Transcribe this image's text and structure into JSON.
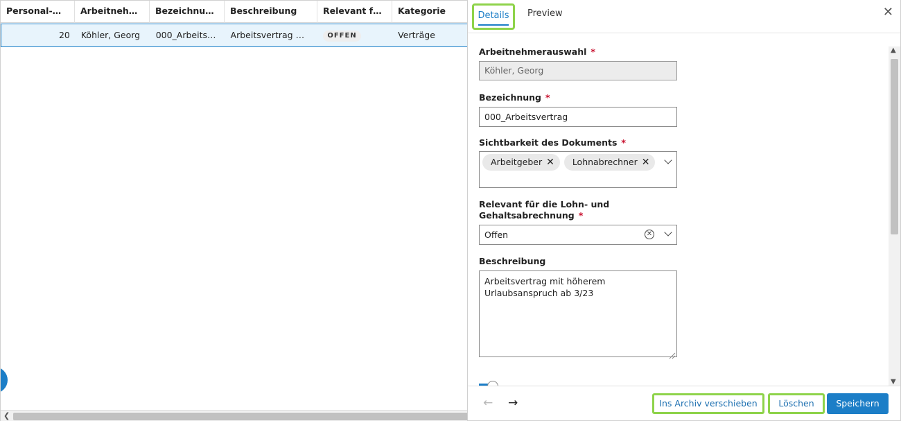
{
  "grid": {
    "columns": [
      "Personal-…",
      "Arbeitneh…",
      "Bezeichnu…",
      "Beschreibung",
      "Relevant für d…",
      "Kategorie"
    ],
    "rows": [
      {
        "personal_nr": "20",
        "arbeitnehmer": "Köhler, Georg",
        "bezeichnung": "000_Arbeitsve…",
        "beschreibung": "Arbeitsvertrag mit …",
        "relevant": "OFFEN",
        "kategorie": "Verträge"
      }
    ]
  },
  "panel": {
    "tabs": [
      {
        "label": "Details",
        "active": true
      },
      {
        "label": "Preview",
        "active": false
      }
    ],
    "form": {
      "arbeitnehmer_label": "Arbeitnehmerauswahl",
      "arbeitnehmer_value": "Köhler, Georg",
      "bezeichnung_label": "Bezeichnung",
      "bezeichnung_value": "000_Arbeitsvertrag",
      "sichtbarkeit_label": "Sichtbarkeit des Dokuments",
      "sichtbarkeit_chips": [
        "Arbeitgeber",
        "Lohnabrechner"
      ],
      "relevant_label_line1": "Relevant für die Lohn- und",
      "relevant_label_line2": "Gehaltsabrechnung",
      "relevant_value": "Offen",
      "beschreibung_label": "Beschreibung",
      "beschreibung_value": "Arbeitsvertrag mit höherem Urlaubsanspruch ab 3/23",
      "required_mark": "*"
    },
    "footer": {
      "archive_label": "Ins Archiv verschieben",
      "delete_label": "Löschen",
      "save_label": "Speichern"
    }
  },
  "colors": {
    "accent": "#1c7ec7",
    "highlight": "#8ed34a",
    "required": "#c8102e"
  }
}
